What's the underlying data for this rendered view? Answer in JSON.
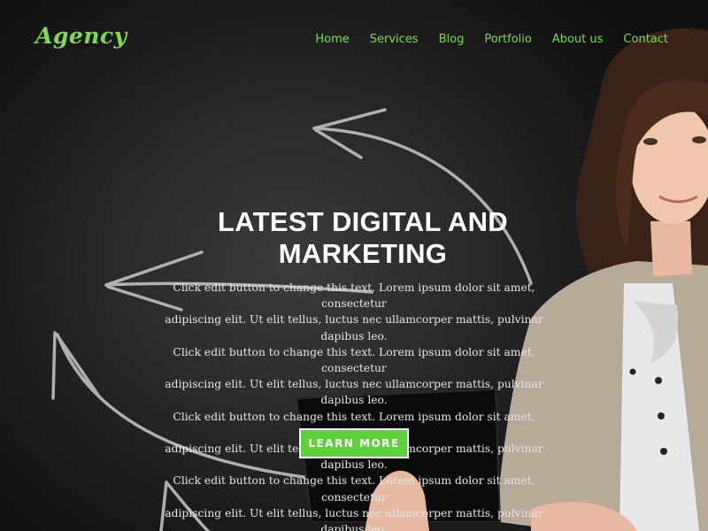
{
  "brand": {
    "logo_text": "Agency"
  },
  "nav": {
    "items": [
      {
        "label": "Home"
      },
      {
        "label": "Services"
      },
      {
        "label": "Blog"
      },
      {
        "label": "Portfolio"
      },
      {
        "label": "About us"
      },
      {
        "label": "Contact"
      }
    ]
  },
  "hero": {
    "headline_line1": "LATEST DIGITAL AND",
    "headline_line2": "MARKETING",
    "body_lines": [
      "Click edit button to change this text. Lorem ipsum dolor sit amet, consectetur",
      "adipiscing elit. Ut elit tellus, luctus nec ullamcorper mattis, pulvinar dapibus leo.",
      "Click edit button to change this text. Lorem ipsum dolor sit amet, consectetur",
      "adipiscing elit. Ut elit tellus, luctus nec ullamcorper mattis, pulvinar dapibus leo.",
      "Click edit button to change this text. Lorem ipsum dolor sit amet, consectetur",
      "adipiscing elit. Ut elit tellus, luctus nec ullamcorper mattis, pulvinar dapibus leo.",
      "Click edit button to change this text. Lorem ipsum dolor sit amet, consectetur",
      "adipiscing elit. Ut elit tellus, luctus nec ullamcorper mattis, pulvinar dapibus leo."
    ],
    "cta_label": "LEARN MORE"
  },
  "colors": {
    "accent": "#7ed957",
    "button": "#5fcf3e",
    "background": "#1c1c1c"
  }
}
